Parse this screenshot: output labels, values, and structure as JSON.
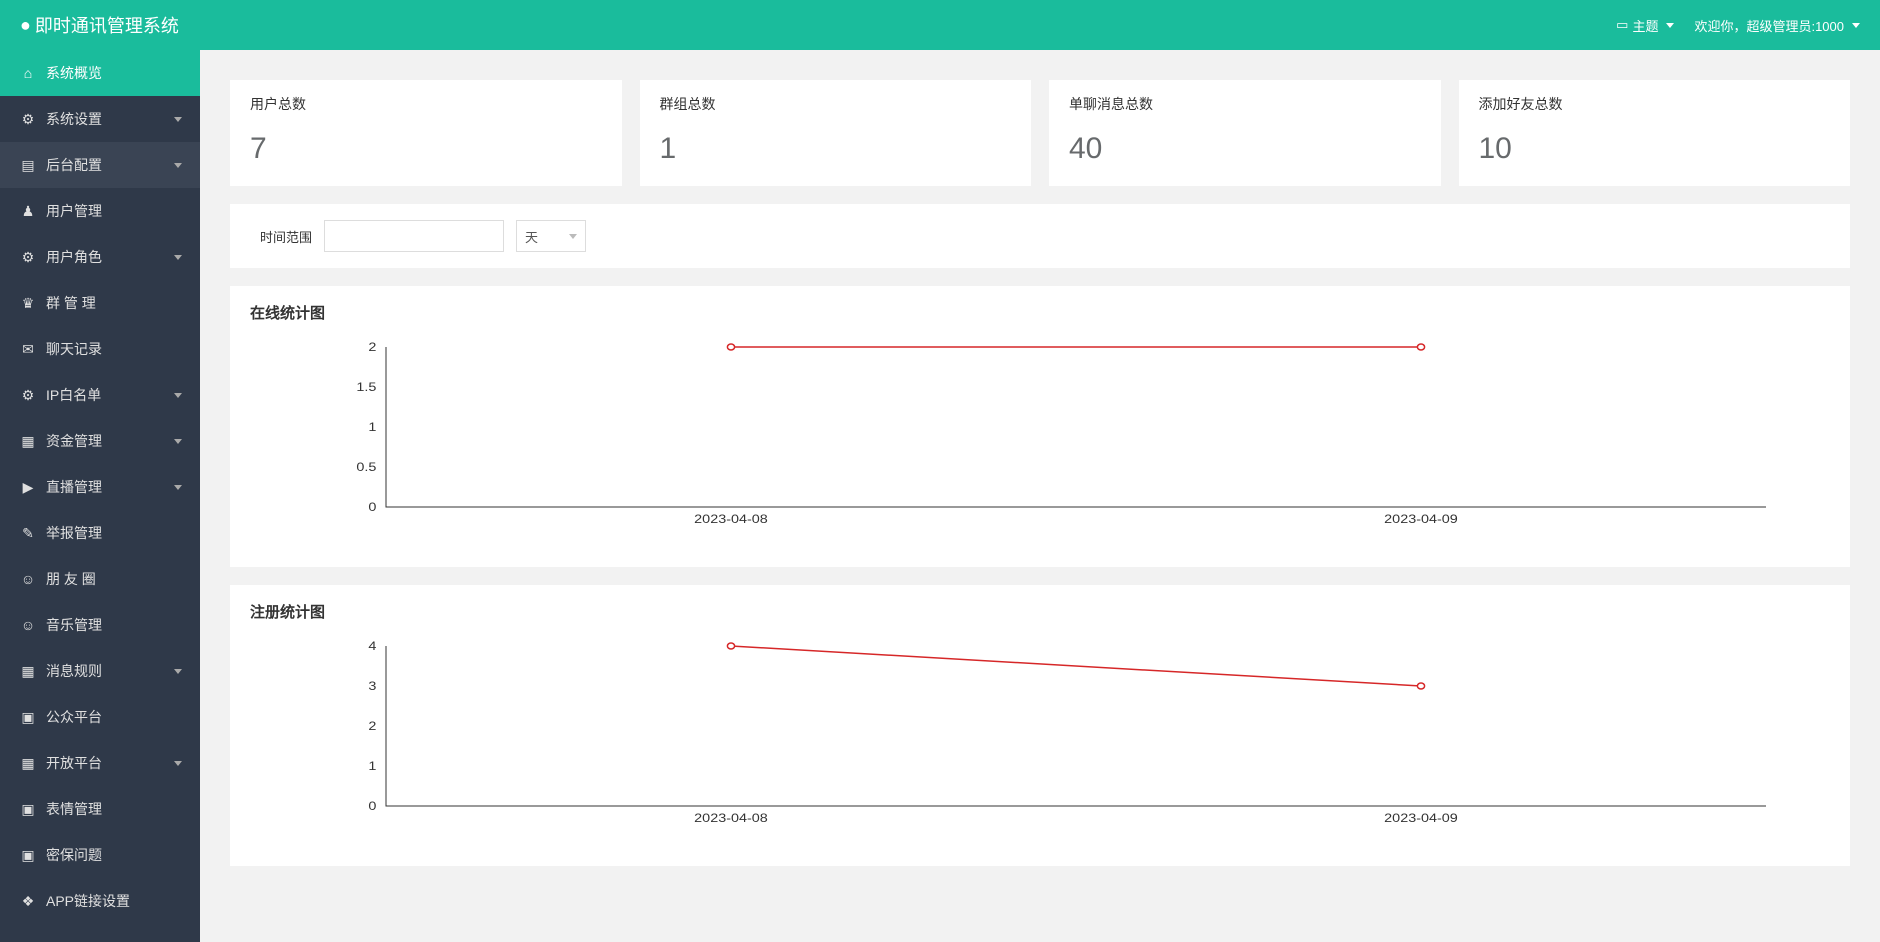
{
  "header": {
    "title": "即时通讯管理系统",
    "theme_label": "主题",
    "welcome": "欢迎你，超级管理员:1000"
  },
  "sidebar": {
    "items": [
      {
        "icon": "⌂",
        "label": "系统概览",
        "active": true,
        "expandable": false
      },
      {
        "icon": "⚙",
        "label": "系统设置",
        "expandable": true
      },
      {
        "icon": "▤",
        "label": "后台配置",
        "expandable": true,
        "selected": true
      },
      {
        "icon": "♟",
        "label": "用户管理",
        "expandable": false
      },
      {
        "icon": "⚙",
        "label": "用户角色",
        "expandable": true
      },
      {
        "icon": "♛",
        "label": "群 管 理",
        "expandable": false
      },
      {
        "icon": "✉",
        "label": "聊天记录",
        "expandable": false
      },
      {
        "icon": "⚙",
        "label": "IP白名单",
        "expandable": true
      },
      {
        "icon": "▦",
        "label": "资金管理",
        "expandable": true
      },
      {
        "icon": "▶",
        "label": "直播管理",
        "expandable": true
      },
      {
        "icon": "✎",
        "label": "举报管理",
        "expandable": false
      },
      {
        "icon": "☺",
        "label": "朋 友 圈",
        "expandable": false
      },
      {
        "icon": "☺",
        "label": "音乐管理",
        "expandable": false
      },
      {
        "icon": "▦",
        "label": "消息规则",
        "expandable": true
      },
      {
        "icon": "▣",
        "label": "公众平台",
        "expandable": false
      },
      {
        "icon": "▦",
        "label": "开放平台",
        "expandable": true
      },
      {
        "icon": "▣",
        "label": "表情管理",
        "expandable": false
      },
      {
        "icon": "▣",
        "label": "密保问题",
        "expandable": false
      },
      {
        "icon": "❖",
        "label": "APP链接设置",
        "expandable": false
      }
    ]
  },
  "stats": [
    {
      "label": "用户总数",
      "value": "7"
    },
    {
      "label": "群组总数",
      "value": "1"
    },
    {
      "label": "单聊消息总数",
      "value": "40"
    },
    {
      "label": "添加好友总数",
      "value": "10"
    }
  ],
  "filter": {
    "label": "时间范围",
    "unit": "天"
  },
  "chart1": {
    "title": "在线统计图"
  },
  "chart2": {
    "title": "注册统计图"
  },
  "chart_data": [
    {
      "type": "line",
      "title": "在线统计图",
      "x": [
        "2023-04-08",
        "2023-04-09"
      ],
      "values": [
        2,
        2
      ],
      "ylim": [
        0,
        2
      ],
      "yticks": [
        0,
        0.5,
        1,
        1.5,
        2
      ]
    },
    {
      "type": "line",
      "title": "注册统计图",
      "x": [
        "2023-04-08",
        "2023-04-09"
      ],
      "values": [
        4,
        3
      ],
      "ylim": [
        0,
        4
      ],
      "yticks": [
        0,
        1,
        2,
        3,
        4
      ]
    }
  ]
}
